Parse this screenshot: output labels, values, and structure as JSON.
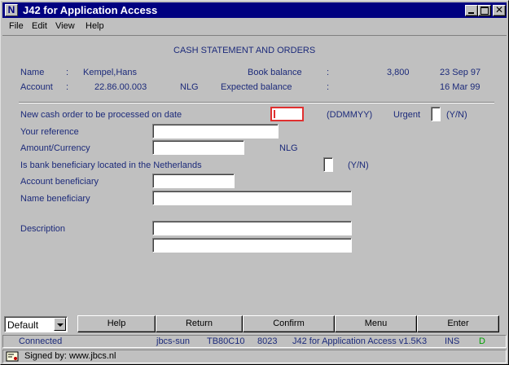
{
  "window": {
    "title": "J42 for Application Access",
    "icon_letter": "N",
    "close_glyph": "✕"
  },
  "menu": [
    "File",
    "Edit",
    "View",
    "Help"
  ],
  "screen": {
    "heading": "CASH STATEMENT AND ORDERS",
    "name_label": "Name",
    "colon": ":",
    "name_value": "Kempel,Hans",
    "account_label": "Account",
    "account_value": "22.86.00.003",
    "currency": "NLG",
    "book_balance_label": "Book balance",
    "book_balance_value": "3,800",
    "book_balance_date": "23 Sep 97",
    "expected_balance_label": "Expected balance",
    "expected_balance_date": "16 Mar 99"
  },
  "form": {
    "new_order_label": "New cash order to be processed on date",
    "date_format": "(DDMMYY)",
    "urgent_label": "Urgent",
    "yn": "(Y/N)",
    "your_reference_label": "Your reference",
    "amount_currency_label": "Amount/Currency",
    "amount_currency_unit": "NLG",
    "bank_nl_label": "Is bank beneficiary located in the Netherlands",
    "account_beneficiary_label": "Account beneficiary",
    "name_beneficiary_label": "Name beneficiary",
    "description_label": "Description"
  },
  "buttons": {
    "select_value": "Default",
    "help": "Help",
    "return": "Return",
    "confirm": "Confirm",
    "menu": "Menu",
    "enter": "Enter"
  },
  "status": {
    "connection": "Connected",
    "host": "jbcs-sun",
    "terminal": "TB80C10",
    "port": "8023",
    "product": "J42 for Application Access v1.5K3",
    "mode": "INS",
    "flag": "D"
  },
  "signature": {
    "text": "Signed by: www.jbcs.nl"
  },
  "colors": {
    "titlebar": "#000080",
    "label_text": "#1c2a7a",
    "focus_border": "#e03030",
    "status_green": "#00a000"
  }
}
